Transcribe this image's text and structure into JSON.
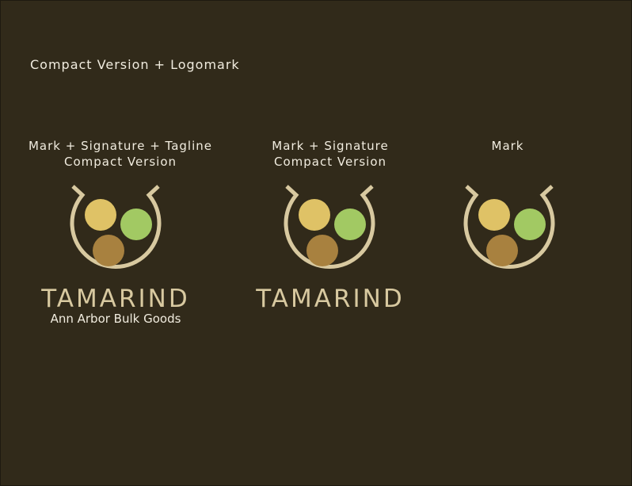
{
  "heading": "Compact Version + Logomark",
  "variants": [
    {
      "caption_line1": "Mark + Signature + Tagline",
      "caption_line2": "Compact Version",
      "wordmark": "TAMARIND",
      "tagline": "Ann Arbor Bulk Goods"
    },
    {
      "caption_line1": "Mark + Signature",
      "caption_line2": "Compact Version",
      "wordmark": "TAMARIND"
    },
    {
      "caption_line1": "Mark"
    }
  ],
  "colors": {
    "background": "#312a1a",
    "ring": "#d8c9a0",
    "circle_yellow": "#dfc266",
    "circle_green": "#a2c963",
    "circle_brown": "#a8813f",
    "text": "#f1ecdf"
  }
}
